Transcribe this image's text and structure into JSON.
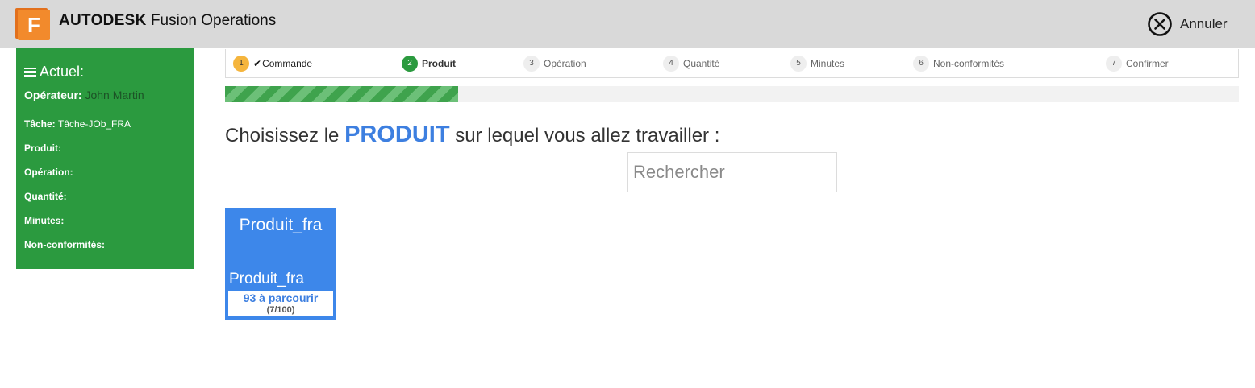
{
  "header": {
    "logo_letter": "F",
    "brand_primary": "AUTODESK",
    "brand_secondary": "Fusion Operations",
    "cancel_label": "Annuler"
  },
  "sidebar": {
    "title": "Actuel:",
    "operator_label": "Opérateur",
    "operator_value": "John Martin",
    "rows": [
      {
        "label": "Tâche:",
        "value": "Tâche-JOb_FRA"
      },
      {
        "label": "Produit:",
        "value": ""
      },
      {
        "label": "Opération:",
        "value": ""
      },
      {
        "label": "Quantité:",
        "value": ""
      },
      {
        "label": "Minutes:",
        "value": ""
      },
      {
        "label": "Non-conformités:",
        "value": ""
      }
    ]
  },
  "steps": [
    {
      "num": "1",
      "label": "Commande",
      "state": "done"
    },
    {
      "num": "2",
      "label": "Produit",
      "state": "active"
    },
    {
      "num": "3",
      "label": "Opération",
      "state": "pending"
    },
    {
      "num": "4",
      "label": "Quantité",
      "state": "pending"
    },
    {
      "num": "5",
      "label": "Minutes",
      "state": "pending"
    },
    {
      "num": "6",
      "label": "Non-conformités",
      "state": "pending"
    },
    {
      "num": "7",
      "label": "Confirmer",
      "state": "pending"
    }
  ],
  "progress": {
    "fraction": 0.23
  },
  "main": {
    "heading_pre": "Choisissez le",
    "heading_keyword": "PRODUIT",
    "heading_post": "sur lequel vous allez travailler :",
    "search_placeholder": "Rechercher"
  },
  "products": [
    {
      "title": "Produit_fra",
      "name": "Produit_fra",
      "remaining": "93 à parcourir",
      "ratio": "(7/100)"
    }
  ],
  "colors": {
    "header_bg": "#d9d9d9",
    "sidebar_green": "#2b9a3f",
    "accent_blue": "#3d7fe0",
    "card_blue": "#3d87ea",
    "step_done": "#f5b53d"
  }
}
